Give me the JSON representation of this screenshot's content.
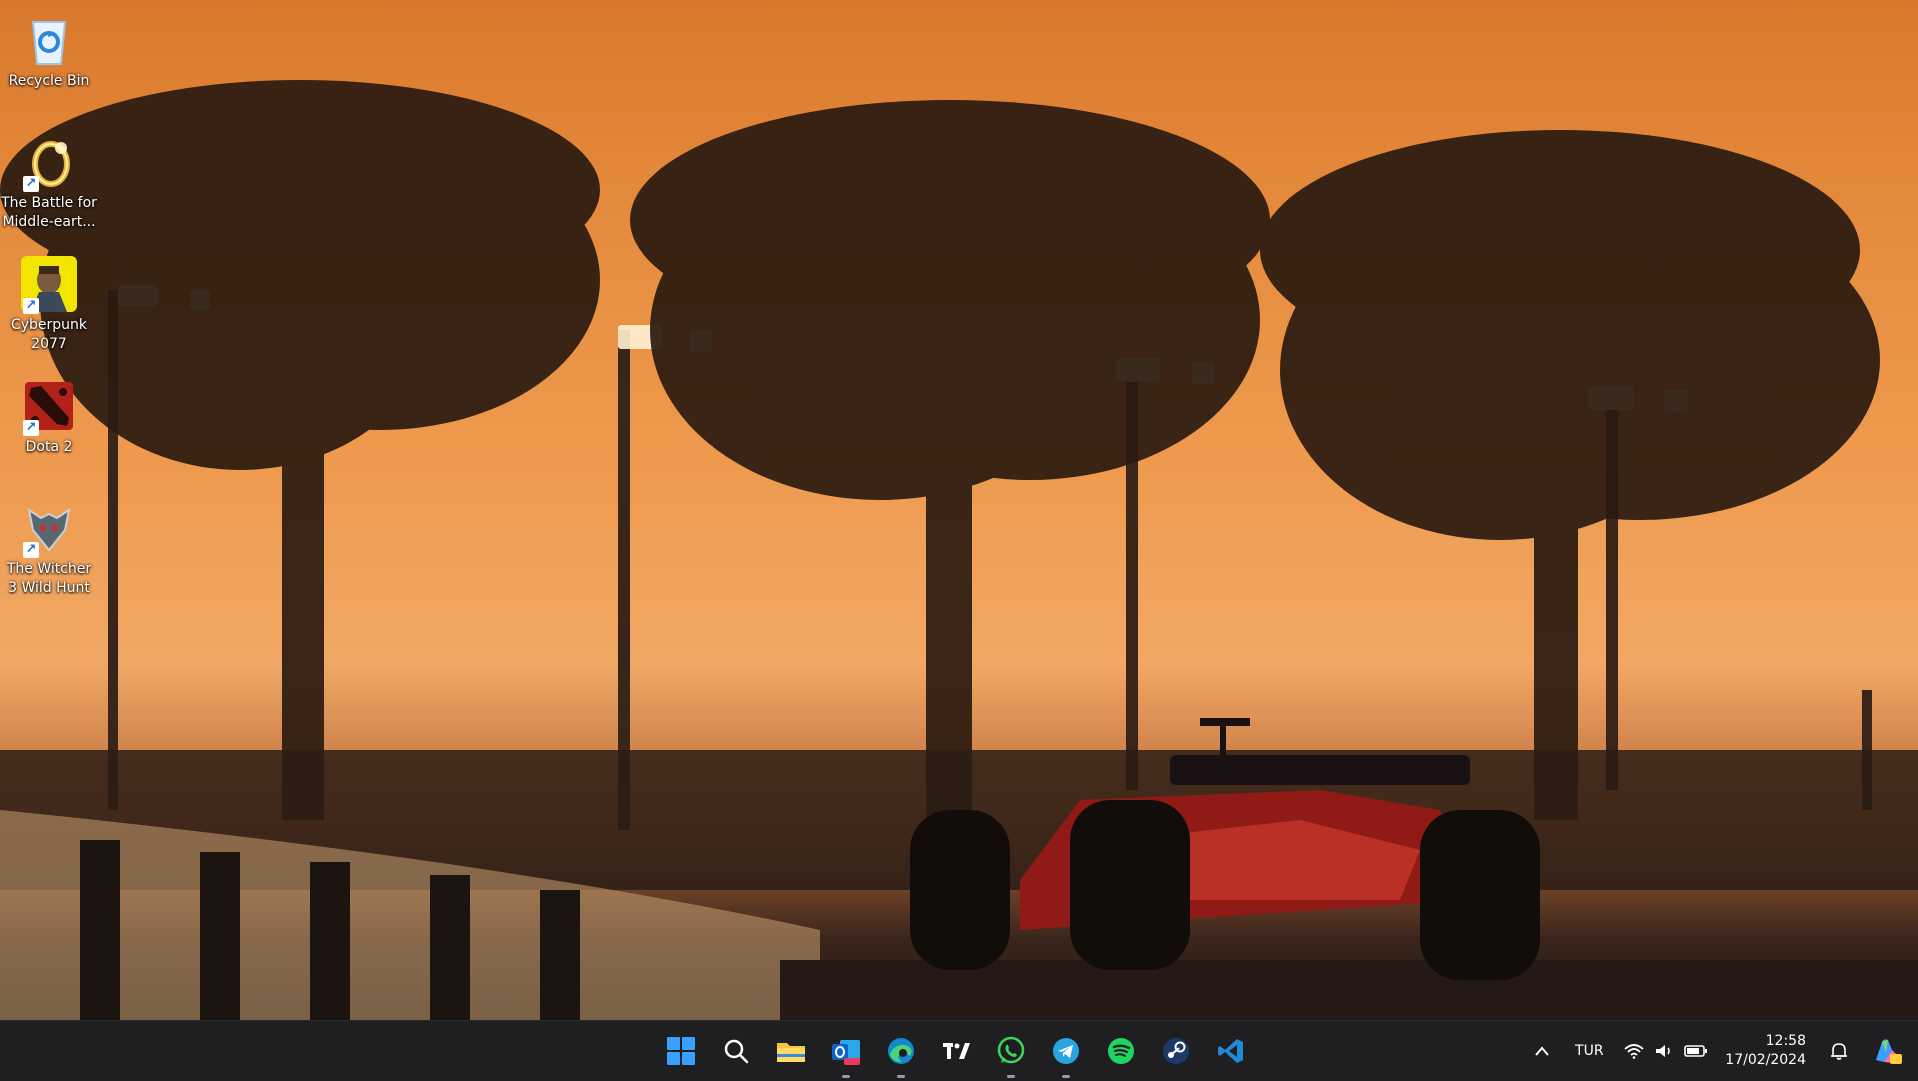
{
  "desktop": {
    "icons": [
      {
        "label": "Recycle Bin",
        "icon": "recycle-bin-icon",
        "shortcut": false
      },
      {
        "label": "The Battle for Middle-eart...",
        "icon": "ring-icon",
        "shortcut": true
      },
      {
        "label": "Cyberpunk 2077",
        "icon": "cyberpunk-icon",
        "shortcut": true
      },
      {
        "label": "Dota 2",
        "icon": "dota-icon",
        "shortcut": true
      },
      {
        "label": "The Witcher 3 Wild Hunt",
        "icon": "witcher-wolf-icon",
        "shortcut": true
      }
    ]
  },
  "taskbar": {
    "apps": [
      {
        "name": "start-button",
        "icon": "windows-logo-icon",
        "running": false
      },
      {
        "name": "search-button",
        "icon": "search-icon",
        "running": false
      },
      {
        "name": "file-explorer-button",
        "icon": "folder-icon",
        "running": false
      },
      {
        "name": "outlook-button",
        "icon": "outlook-icon",
        "running": true
      },
      {
        "name": "edge-button",
        "icon": "edge-icon",
        "running": true
      },
      {
        "name": "tradingview-button",
        "icon": "tradingview-icon",
        "running": false
      },
      {
        "name": "whatsapp-button",
        "icon": "whatsapp-icon",
        "running": true
      },
      {
        "name": "telegram-button",
        "icon": "telegram-icon",
        "running": true
      },
      {
        "name": "spotify-button",
        "icon": "spotify-icon",
        "running": false
      },
      {
        "name": "steam-button",
        "icon": "steam-icon",
        "running": false
      },
      {
        "name": "vscode-button",
        "icon": "vscode-icon",
        "running": false
      }
    ],
    "tray": {
      "language": "TUR",
      "time": "12:58",
      "date": "17/02/2024"
    }
  },
  "colors": {
    "taskbar_bg": "#1f1f22",
    "accent": "#3aa0ff",
    "sky": "#e58a3c"
  }
}
